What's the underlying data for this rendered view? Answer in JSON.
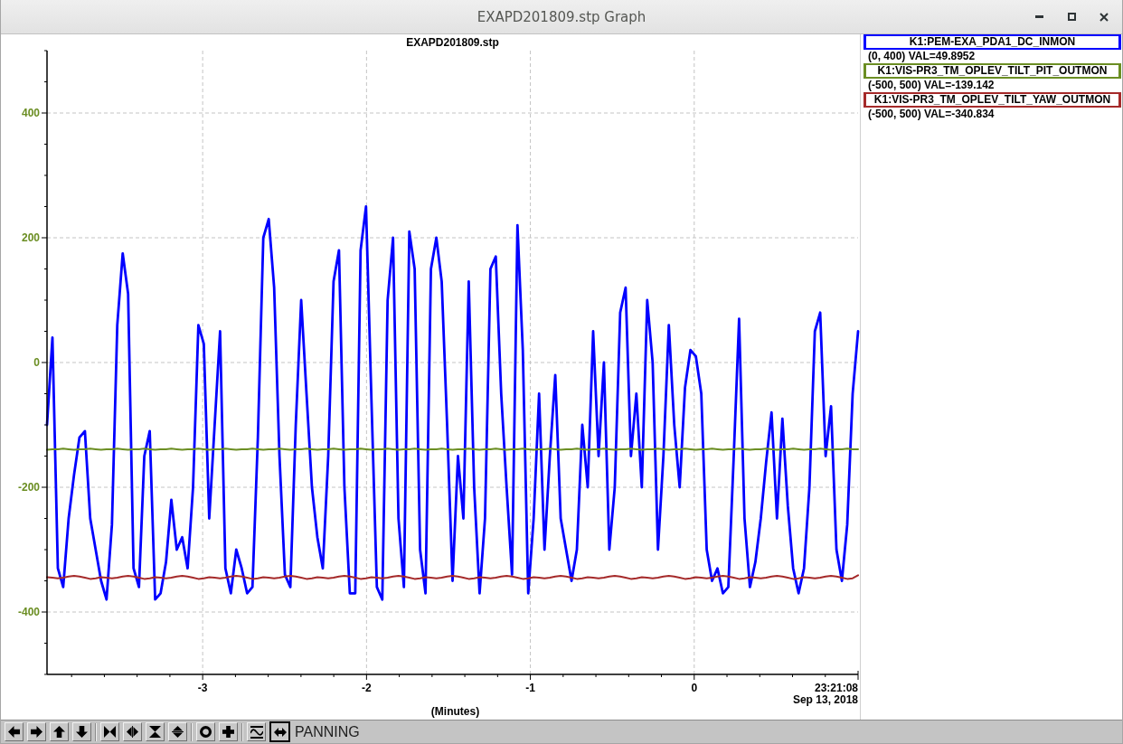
{
  "window": {
    "title": "EXAPD201809.stp Graph"
  },
  "graph": {
    "end_time": "23:21:08",
    "end_date": "Sep 13, 2018",
    "chart_data": {
      "type": "line",
      "title": "EXAPD201809.stp",
      "xlabel": "(Minutes)",
      "grid": true,
      "xlim": [
        -3.95,
        1.0
      ],
      "ylim": [
        -500,
        500
      ],
      "xticks": [
        -3,
        -2,
        -1,
        0
      ],
      "yticks": [
        -400,
        -200,
        0,
        200,
        400
      ],
      "x": [
        -3.95,
        -3.917,
        -3.884,
        -3.851,
        -3.818,
        -3.785,
        -3.752,
        -3.719,
        -3.686,
        -3.653,
        -3.62,
        -3.587,
        -3.554,
        -3.521,
        -3.488,
        -3.455,
        -3.422,
        -3.389,
        -3.356,
        -3.323,
        -3.29,
        -3.257,
        -3.224,
        -3.191,
        -3.158,
        -3.125,
        -3.092,
        -3.059,
        -3.026,
        -2.993,
        -2.96,
        -2.927,
        -2.894,
        -2.861,
        -2.828,
        -2.795,
        -2.762,
        -2.729,
        -2.696,
        -2.663,
        -2.63,
        -2.597,
        -2.564,
        -2.531,
        -2.498,
        -2.465,
        -2.432,
        -2.399,
        -2.366,
        -2.333,
        -2.3,
        -2.267,
        -2.234,
        -2.201,
        -2.168,
        -2.135,
        -2.102,
        -2.069,
        -2.036,
        -2.003,
        -1.97,
        -1.937,
        -1.904,
        -1.871,
        -1.838,
        -1.805,
        -1.772,
        -1.739,
        -1.706,
        -1.673,
        -1.64,
        -1.607,
        -1.574,
        -1.541,
        -1.508,
        -1.475,
        -1.442,
        -1.409,
        -1.376,
        -1.343,
        -1.31,
        -1.277,
        -1.244,
        -1.211,
        -1.178,
        -1.145,
        -1.112,
        -1.079,
        -1.046,
        -1.013,
        -0.98,
        -0.947,
        -0.914,
        -0.881,
        -0.848,
        -0.815,
        -0.782,
        -0.749,
        -0.716,
        -0.683,
        -0.65,
        -0.617,
        -0.584,
        -0.551,
        -0.518,
        -0.485,
        -0.452,
        -0.419,
        -0.386,
        -0.353,
        -0.32,
        -0.287,
        -0.254,
        -0.221,
        -0.188,
        -0.155,
        -0.122,
        -0.089,
        -0.056,
        -0.023,
        0.01,
        0.043,
        0.076,
        0.109,
        0.142,
        0.175,
        0.208,
        0.241,
        0.274,
        0.307,
        0.34,
        0.373,
        0.406,
        0.439,
        0.472,
        0.505,
        0.538,
        0.571,
        0.604,
        0.637,
        0.67,
        0.703,
        0.736,
        0.769,
        0.802,
        0.835,
        0.868,
        0.901,
        0.934,
        0.967,
        1.0
      ],
      "series": [
        {
          "name": "K1:PEM-EXA_PDA1_DC_INMON",
          "color": "#0000ff",
          "values": [
            -100,
            40,
            -330,
            -360,
            -250,
            -180,
            -120,
            -110,
            -250,
            -300,
            -350,
            -380,
            -260,
            60,
            175,
            110,
            -330,
            -360,
            -150,
            -110,
            -380,
            -370,
            -320,
            -220,
            -300,
            -280,
            -330,
            -200,
            60,
            30,
            -250,
            -100,
            50,
            -330,
            -370,
            -300,
            -330,
            -370,
            -360,
            -120,
            200,
            230,
            120,
            -150,
            -340,
            -360,
            -100,
            100,
            -50,
            -200,
            -280,
            -330,
            -150,
            130,
            180,
            -200,
            -370,
            -370,
            180,
            250,
            -60,
            -360,
            -380,
            100,
            200,
            -250,
            -360,
            210,
            150,
            -300,
            -370,
            150,
            200,
            130,
            -100,
            -350,
            -150,
            -250,
            130,
            -200,
            -370,
            -250,
            150,
            170,
            -50,
            -200,
            -340,
            220,
            20,
            -370,
            -250,
            -50,
            -300,
            -150,
            -20,
            -250,
            -300,
            -350,
            -300,
            -100,
            -200,
            50,
            -150,
            0,
            -300,
            -200,
            80,
            120,
            -150,
            -50,
            -200,
            100,
            0,
            -300,
            -150,
            60,
            -100,
            -200,
            -40,
            20,
            10,
            -50,
            -300,
            -350,
            -330,
            -370,
            -360,
            -150,
            70,
            -250,
            -360,
            -320,
            -250,
            -160,
            -80,
            -250,
            -90,
            -230,
            -330,
            -370,
            -330,
            -200,
            50,
            80,
            -150,
            -70,
            -300,
            -350,
            -260,
            -50,
            50
          ]
        },
        {
          "name": "K1:VIS-PR3_TM_OPLEV_TILT_PIT_OUTMON",
          "color": "#6b8e23",
          "values": [
            -140,
            -139,
            -139,
            -138,
            -139,
            -140,
            -139,
            -139,
            -138,
            -139,
            -140,
            -139,
            -139,
            -138,
            -139,
            -140,
            -139,
            -139,
            -138,
            -139,
            -140,
            -139,
            -139,
            -138,
            -139,
            -140,
            -139,
            -139,
            -138,
            -139,
            -140,
            -139,
            -139,
            -138,
            -139,
            -140,
            -139,
            -139,
            -138,
            -139,
            -140,
            -139,
            -139,
            -138,
            -139,
            -140,
            -139,
            -139,
            -138,
            -139,
            -140,
            -139,
            -139,
            -138,
            -139,
            -140,
            -139,
            -139,
            -138,
            -139,
            -140,
            -139,
            -139,
            -138,
            -139,
            -140,
            -139,
            -139,
            -138,
            -139,
            -140,
            -139,
            -139,
            -138,
            -139,
            -140,
            -139,
            -139,
            -138,
            -139,
            -140,
            -139,
            -139,
            -138,
            -139,
            -140,
            -139,
            -139,
            -138,
            -139,
            -140,
            -139,
            -139,
            -138,
            -139,
            -140,
            -139,
            -139,
            -138,
            -139,
            -140,
            -139,
            -139,
            -138,
            -139,
            -140,
            -139,
            -139,
            -138,
            -139,
            -140,
            -139,
            -139,
            -138,
            -139,
            -140,
            -139,
            -139,
            -138,
            -139,
            -140,
            -139,
            -139,
            -138,
            -139,
            -140,
            -139,
            -139,
            -138,
            -139,
            -140,
            -139,
            -139,
            -138,
            -139,
            -140,
            -139,
            -139,
            -138,
            -139,
            -140,
            -139,
            -139,
            -138,
            -139,
            -140,
            -139,
            -139,
            -138,
            -139,
            -139
          ]
        },
        {
          "name": "K1:VIS-PR3_TM_OPLEV_TILT_YAW_OUTMON",
          "color": "#a52a2a",
          "values": [
            -344,
            -345,
            -346,
            -345,
            -343,
            -342,
            -343,
            -345,
            -347,
            -346,
            -344,
            -345,
            -346,
            -345,
            -343,
            -342,
            -343,
            -345,
            -347,
            -346,
            -344,
            -345,
            -346,
            -345,
            -343,
            -342,
            -343,
            -345,
            -347,
            -346,
            -344,
            -345,
            -346,
            -345,
            -343,
            -342,
            -343,
            -345,
            -347,
            -346,
            -344,
            -345,
            -346,
            -345,
            -343,
            -342,
            -343,
            -345,
            -347,
            -346,
            -344,
            -345,
            -346,
            -345,
            -343,
            -342,
            -343,
            -345,
            -347,
            -346,
            -344,
            -345,
            -346,
            -345,
            -343,
            -342,
            -343,
            -345,
            -347,
            -346,
            -344,
            -345,
            -346,
            -345,
            -343,
            -342,
            -343,
            -345,
            -347,
            -346,
            -344,
            -345,
            -346,
            -345,
            -343,
            -342,
            -343,
            -345,
            -347,
            -346,
            -344,
            -345,
            -346,
            -345,
            -343,
            -342,
            -343,
            -345,
            -347,
            -346,
            -344,
            -345,
            -346,
            -345,
            -343,
            -342,
            -343,
            -345,
            -347,
            -346,
            -344,
            -345,
            -346,
            -345,
            -343,
            -342,
            -343,
            -345,
            -347,
            -346,
            -344,
            -345,
            -346,
            -345,
            -343,
            -342,
            -343,
            -345,
            -347,
            -346,
            -344,
            -345,
            -346,
            -345,
            -343,
            -342,
            -343,
            -345,
            -347,
            -346,
            -344,
            -345,
            -346,
            -345,
            -343,
            -342,
            -343,
            -345,
            -347,
            -346,
            -341
          ]
        }
      ]
    }
  },
  "legend": [
    {
      "reading": "(0, 400) VAL=49.8952"
    },
    {
      "reading": "(-500, 500) VAL=-139.142"
    },
    {
      "reading": "(-500, 500) VAL=-340.834"
    }
  ],
  "toolbar": {
    "mode_buttons": [
      {
        "selected": false
      },
      {
        "selected": true
      }
    ],
    "mode_label": "PANNING"
  }
}
